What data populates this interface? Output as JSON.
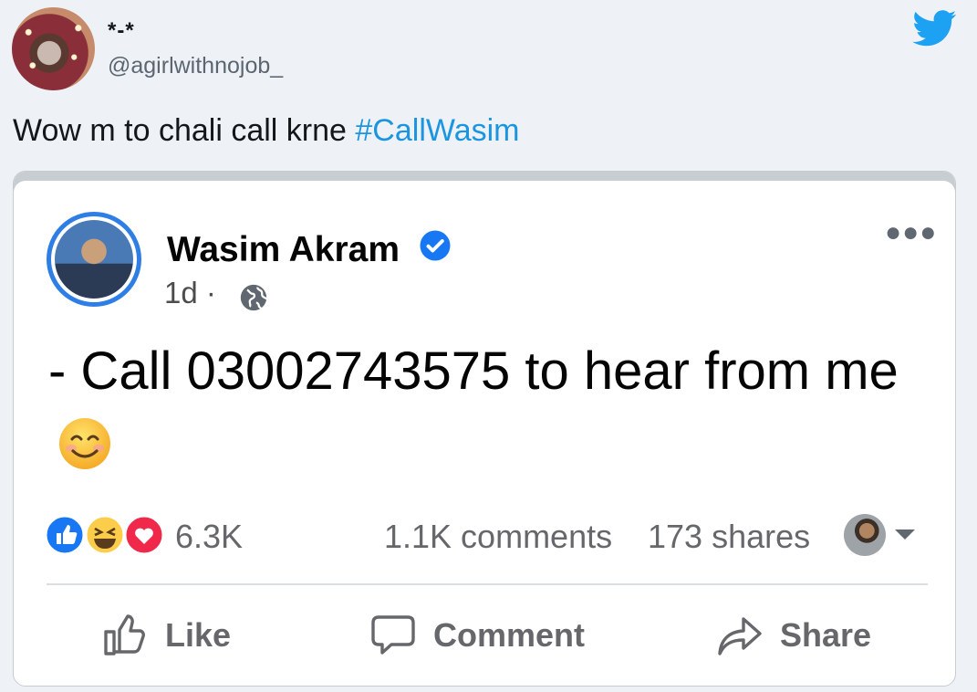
{
  "tweet": {
    "display_name": "*-*",
    "handle": "@agirlwithnojob_",
    "text": "Wow m to chali call krne ",
    "hashtag": "#CallWasim"
  },
  "embedded_post": {
    "author": "Wasim Akram",
    "time": "1d ·",
    "text": "- Call 03002743575 to hear from me",
    "reactions_count": "6.3K",
    "comments": "1.1K comments",
    "shares": "173 shares",
    "actions": {
      "like": "Like",
      "comment": "Comment",
      "share": "Share"
    }
  },
  "colors": {
    "twitter_blue": "#1da1f2",
    "hashtag": "#1b95e0",
    "fb_blue": "#2e7ee6",
    "text_gray": "#65676b"
  },
  "icons": [
    "twitter-bird-icon",
    "verified-badge-icon",
    "globe-icon",
    "more-options-icon",
    "like-reaction-icon",
    "haha-reaction-icon",
    "love-reaction-icon",
    "thumbs-up-icon",
    "comment-icon",
    "share-arrow-icon",
    "smiling-emoji-icon",
    "caret-down-icon"
  ]
}
